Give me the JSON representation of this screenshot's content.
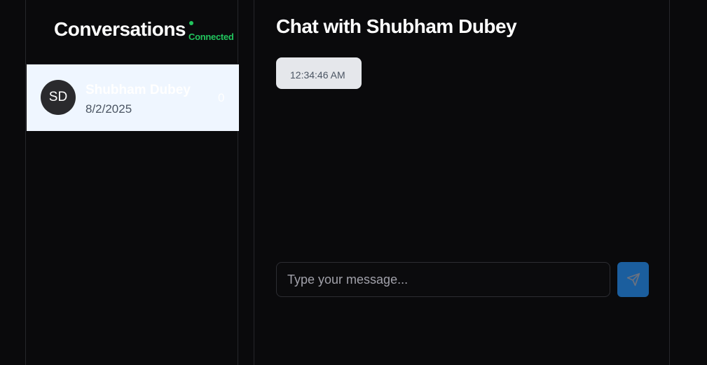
{
  "sidebar": {
    "title": "Conversations",
    "connection_status": "Connected",
    "status_color": "#22c55e",
    "conversations": [
      {
        "initials": "SD",
        "name": "Shubham Dubey",
        "date": "8/2/2025",
        "unread_count": "0"
      }
    ]
  },
  "chat": {
    "title": "Chat with Shubham Dubey",
    "messages": [
      {
        "time": "12:34:46 AM"
      }
    ],
    "input": {
      "value": "",
      "placeholder": "Type your message..."
    },
    "send_icon": "send-icon"
  },
  "colors": {
    "background": "#0a0a0c",
    "selected_item_bg": "#eff6ff",
    "send_button_bg": "#1b5e9e",
    "message_bubble_bg": "#e5e7eb"
  }
}
